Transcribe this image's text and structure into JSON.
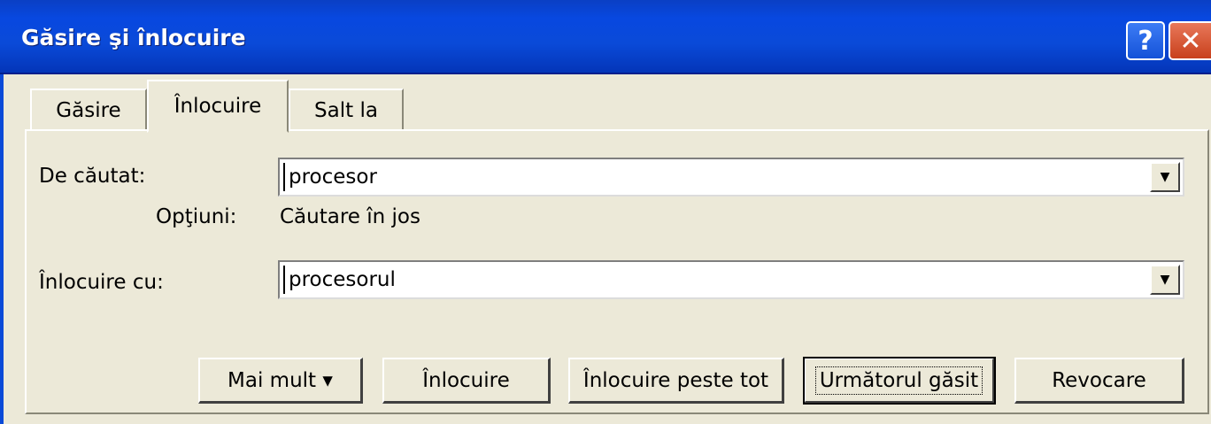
{
  "window": {
    "title": "Găsire şi înlocuire"
  },
  "titlebar": {
    "help_label": "?",
    "close_label": "✕"
  },
  "tabs": [
    {
      "label": "Găsire",
      "active": false
    },
    {
      "label": "Înlocuire",
      "active": true
    },
    {
      "label": "Salt la",
      "active": false
    }
  ],
  "find": {
    "label": "De căutat:",
    "value": "procesor"
  },
  "options": {
    "label": "Opţiuni:",
    "value": "Căutare în jos"
  },
  "replace": {
    "label": "Înlocuire cu:",
    "value": "procesorul"
  },
  "buttons": {
    "more": "Mai mult  ▾",
    "replace": "Înlocuire",
    "replace_all": "Înlocuire peste tot",
    "find_next": "Următorul găsit",
    "cancel": "Revocare"
  },
  "icons": {
    "dropdown": "▼"
  },
  "colors": {
    "titlebar": "#0848e0",
    "dialog": "#ece9d8",
    "background": "#0000a8"
  }
}
